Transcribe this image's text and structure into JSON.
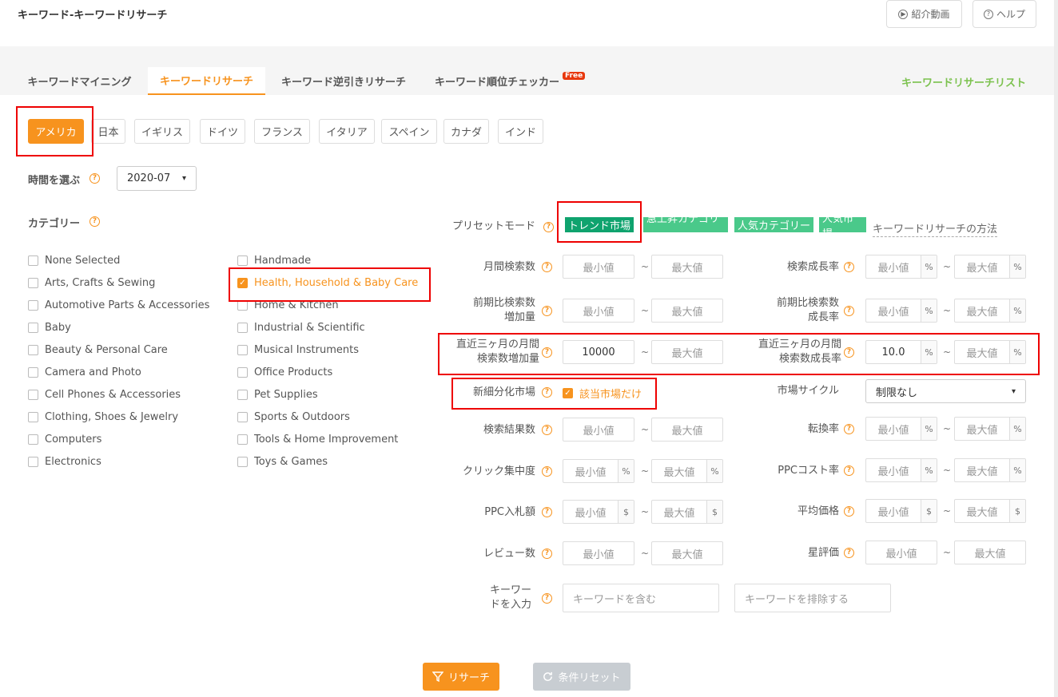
{
  "header": {
    "title": "キーワード-キーワードリサーチ",
    "video_label": "紹介動画",
    "help_label": "ヘルプ"
  },
  "tabs": [
    {
      "label": "キーワードマイニング"
    },
    {
      "label": "キーワードリサーチ",
      "active": true
    },
    {
      "label": "キーワード逆引きリサーチ"
    },
    {
      "label": "キーワード順位チェッカー",
      "badge": "Free"
    }
  ],
  "research_list_link": "キーワードリサーチリスト",
  "countries": [
    {
      "label": "アメリカ",
      "selected": true
    },
    {
      "label": "日本"
    },
    {
      "label": "イギリス"
    },
    {
      "label": "ドイツ"
    },
    {
      "label": "フランス"
    },
    {
      "label": "イタリア"
    },
    {
      "label": "スペイン"
    },
    {
      "label": "カナダ"
    },
    {
      "label": "インド"
    }
  ],
  "time": {
    "label": "時間を選ぶ",
    "value": "2020-07"
  },
  "category": {
    "label": "カテゴリー"
  },
  "categories_left": [
    {
      "label": "None Selected"
    },
    {
      "label": "Arts, Crafts & Sewing"
    },
    {
      "label": "Automotive Parts & Accessories"
    },
    {
      "label": "Baby"
    },
    {
      "label": "Beauty & Personal Care"
    },
    {
      "label": "Camera and Photo"
    },
    {
      "label": "Cell Phones & Accessories"
    },
    {
      "label": "Clothing, Shoes & Jewelry"
    },
    {
      "label": "Computers"
    },
    {
      "label": "Electronics"
    }
  ],
  "categories_right": [
    {
      "label": "Handmade"
    },
    {
      "label": "Health, Household & Baby Care",
      "checked": true
    },
    {
      "label": "Home & Kitchen"
    },
    {
      "label": "Industrial & Scientific"
    },
    {
      "label": "Musical Instruments"
    },
    {
      "label": "Office Products"
    },
    {
      "label": "Pet Supplies"
    },
    {
      "label": "Sports & Outdoors"
    },
    {
      "label": "Tools & Home Improvement"
    },
    {
      "label": "Toys & Games"
    }
  ],
  "preset": {
    "label": "プリセットモード",
    "options": [
      "トレンド市場",
      "急上昇カテゴリー",
      "人気カテゴリー",
      "人気市場"
    ],
    "selected": "トレンド市場",
    "howto": "キーワードリサーチの方法"
  },
  "placeholders": {
    "min": "最小値",
    "max": "最大値"
  },
  "filters": {
    "monthly_search": "月間検索数",
    "search_growth": "検索成長率",
    "prev_increase_1": "前期比検索数",
    "prev_increase_2": "増加量",
    "prev_growth_1": "前期比検索数",
    "prev_growth_2": "成長率",
    "recent3_increase_1": "直近三ヶ月の月間",
    "recent3_increase_2": "検索数増加量",
    "recent3_increase_value": "10000",
    "recent3_growth_1": "直近三ヶ月の月間",
    "recent3_growth_2": "検索数成長率",
    "recent3_growth_value": "10.0",
    "new_segment": "新細分化市場",
    "new_segment_option": "該当市場だけ",
    "market_cycle": "市場サイクル",
    "market_cycle_value": "制限なし",
    "result_count": "検索結果数",
    "conversion": "転換率",
    "click_concentration": "クリック集中度",
    "ppc_cost_rate": "PPCコスト率",
    "ppc_bid": "PPC入札額",
    "avg_price": "平均価格",
    "reviews": "レビュー数",
    "rating": "星評価",
    "keyword_1": "キーワー",
    "keyword_2": "ドを入力",
    "keyword_include_placeholder": "キーワードを含む",
    "keyword_exclude_placeholder": "キーワードを排除する"
  },
  "units": {
    "percent": "%",
    "dollar": "$",
    "tilde": "~",
    "question": "?",
    "check": "✓",
    "caret": "▾"
  },
  "buttons": {
    "research": "リサーチ",
    "reset": "条件リセット"
  },
  "colors": {
    "orange": "#f7931e",
    "green": "#4ac98a",
    "dark_green": "#0fa36e",
    "link_green": "#7cc24f",
    "highlight_red": "#e00000"
  }
}
